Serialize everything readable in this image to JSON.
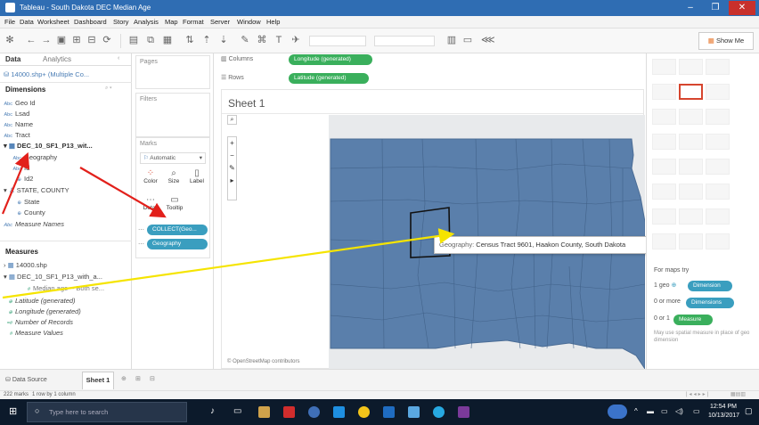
{
  "window": {
    "title": "Tableau - South Dakota DEC Median Age"
  },
  "menu": [
    "File",
    "Data",
    "Worksheet",
    "Dashboard",
    "Story",
    "Analysis",
    "Map",
    "Format",
    "Server",
    "Window",
    "Help"
  ],
  "toolbar": {
    "show_me": "Show Me"
  },
  "data_pane": {
    "tabs": [
      "Data",
      "Analytics"
    ],
    "datasource": "14000.shp+ (Multiple Co...",
    "dimensions_header": "Dimensions",
    "dimensions": [
      {
        "type": "Abc",
        "name": "Geo Id"
      },
      {
        "type": "Abc",
        "name": "Lsad"
      },
      {
        "type": "Abc",
        "name": "Name"
      },
      {
        "type": "Abc",
        "name": "Tract"
      }
    ],
    "table_dec": "DEC_10_SF1_P13_wit...",
    "dec_fields": [
      {
        "type": "Abc",
        "name": "Geography"
      },
      {
        "type": "Abc",
        "name": "Id"
      },
      {
        "type": "⊕",
        "name": "Id2"
      }
    ],
    "hierarchy": "STATE, COUNTY",
    "hier_fields": [
      {
        "type": "⊕",
        "name": "State"
      },
      {
        "type": "⊕",
        "name": "County"
      }
    ],
    "measure_names": "Measure Names",
    "measures_header": "Measures",
    "m_table1": "14000.shp",
    "m_table2": "DEC_10_SF1_P13_with_a...",
    "measures": [
      {
        "type": "#",
        "name": "Median age -- Both se..."
      },
      {
        "type": "⊕",
        "name": "Latitude (generated)"
      },
      {
        "type": "⊕",
        "name": "Longitude (generated)"
      },
      {
        "type": "=#",
        "name": "Number of Records"
      },
      {
        "type": "#",
        "name": "Measure Values"
      }
    ]
  },
  "shelves": {
    "pages": "Pages",
    "filters": "Filters",
    "marks": "Marks",
    "mark_type": "Automatic",
    "mark_buttons": [
      "Color",
      "Size",
      "Label",
      "Detail",
      "Tooltip"
    ],
    "mark_pills": [
      "COLLECT(Geo...",
      "Geography"
    ],
    "columns_label": "Columns",
    "columns_pill": "Longitude (generated)",
    "rows_label": "Rows",
    "rows_pill": "Latitude (generated)"
  },
  "sheet": {
    "title": "Sheet 1",
    "attribution": "© OpenStreetMap contributors",
    "tooltip_label": "Geography:",
    "tooltip_value": "Census Tract 9601, Haakon County, South Dakota"
  },
  "show_me": {
    "for_maps": "For maps try",
    "req1": "1 geo",
    "pill1": "Dimension",
    "req2": "0 or more",
    "pill2": "Dimensions",
    "req3": "0 or 1",
    "pill3": "Measure",
    "note": "May use spatial measure in place of geo dimension"
  },
  "bottom": {
    "data_source_tab": "Data Source",
    "sheet_tab": "Sheet 1",
    "status_marks": "222 marks",
    "status_rows": "1 row by 1 column"
  },
  "taskbar": {
    "search_placeholder": "Type here to search",
    "time": "12:54 PM",
    "date": "10/13/2017"
  },
  "colors": {
    "map_fill": "#5a7fab",
    "pill": "#3a9ebf",
    "titlebar": "#2f6db3",
    "arrow_red": "#e2201b",
    "arrow_yellow": "#f5e400"
  }
}
